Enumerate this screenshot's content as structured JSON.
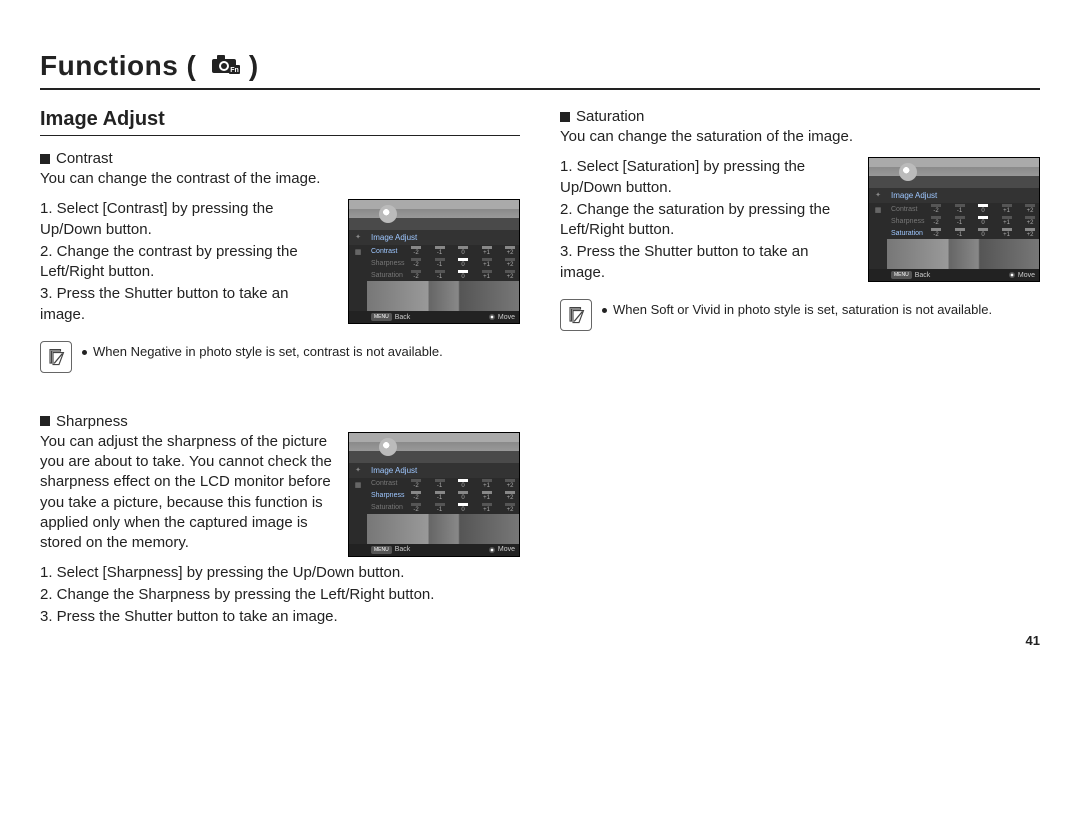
{
  "page_number": "41",
  "title": "Functions",
  "subheading": "Image Adjust",
  "lcd": {
    "header": "Image Adjust",
    "rows": [
      "Contrast",
      "Sharpness",
      "Saturation"
    ],
    "ticks": [
      "-2",
      "-1",
      "0",
      "+1",
      "+2"
    ],
    "footer_back_badge": "MENU",
    "footer_back": "Back",
    "footer_move": "Move"
  },
  "contrast": {
    "label": "Contrast",
    "desc": "You can change the contrast of the image.",
    "steps": [
      "1. Select [Contrast] by pressing the Up/Down button.",
      "2. Change the contrast by pressing the Left/Right button.",
      "3. Press the Shutter button to take an image."
    ],
    "note": "When Negative in photo style is set, contrast is not available."
  },
  "sharpness": {
    "label": "Sharpness",
    "desc": "You can adjust the sharpness of the picture you are about to take. You cannot check the sharpness effect on the LCD monitor before you take a picture, because this function is applied only when the captured image is stored on the memory.",
    "steps": [
      "1. Select [Sharpness] by pressing the Up/Down button.",
      "2. Change the Sharpness by pressing the Left/Right button.",
      "3. Press the Shutter button to take an image."
    ]
  },
  "saturation": {
    "label": "Saturation",
    "desc": "You can change the saturation of the image.",
    "steps": [
      "1. Select [Saturation] by pressing the Up/Down button.",
      "2. Change the saturation by pressing the Left/Right button.",
      "3. Press the Shutter button to take an image."
    ],
    "note": "When Soft or Vivid in photo style is set, saturation is not available."
  }
}
